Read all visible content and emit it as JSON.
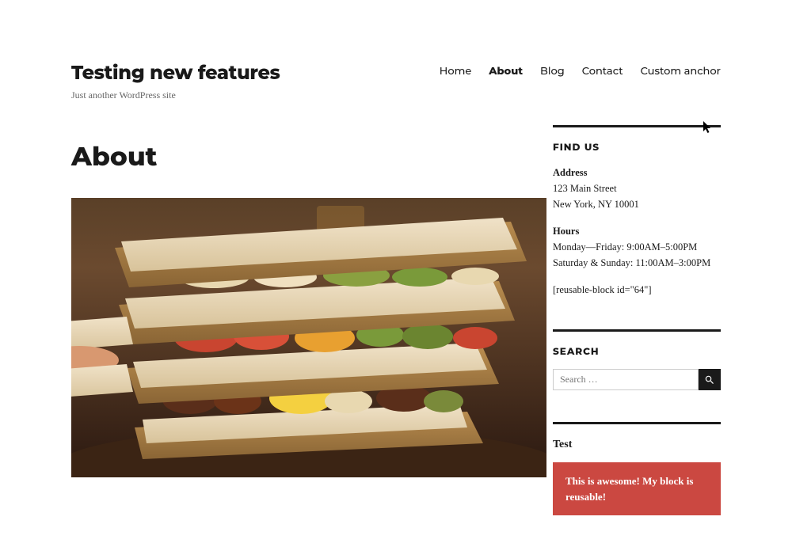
{
  "site": {
    "title": "Testing new features",
    "tagline": "Just another WordPress site"
  },
  "nav": {
    "items": [
      {
        "label": "Home",
        "active": false
      },
      {
        "label": "About",
        "active": true
      },
      {
        "label": "Blog",
        "active": false
      },
      {
        "label": "Contact",
        "active": false
      },
      {
        "label": "Custom anchor",
        "active": false
      }
    ]
  },
  "page": {
    "title": "About",
    "hero_image_alt": "sandwich-photo"
  },
  "sidebar": {
    "find_us": {
      "title": "FIND US",
      "address_label": "Address",
      "address_line1": "123 Main Street",
      "address_line2": "New York, NY 10001",
      "hours_label": "Hours",
      "hours_line1": "Monday—Friday: 9:00AM–5:00PM",
      "hours_line2": "Saturday & Sunday: 11:00AM–3:00PM",
      "shortcode": "[reusable-block id=\"64\"]"
    },
    "search": {
      "title": "SEARCH",
      "placeholder": "Search …"
    },
    "test": {
      "title": "Test",
      "block_text": "This is awesome! My block is reusable!"
    }
  }
}
